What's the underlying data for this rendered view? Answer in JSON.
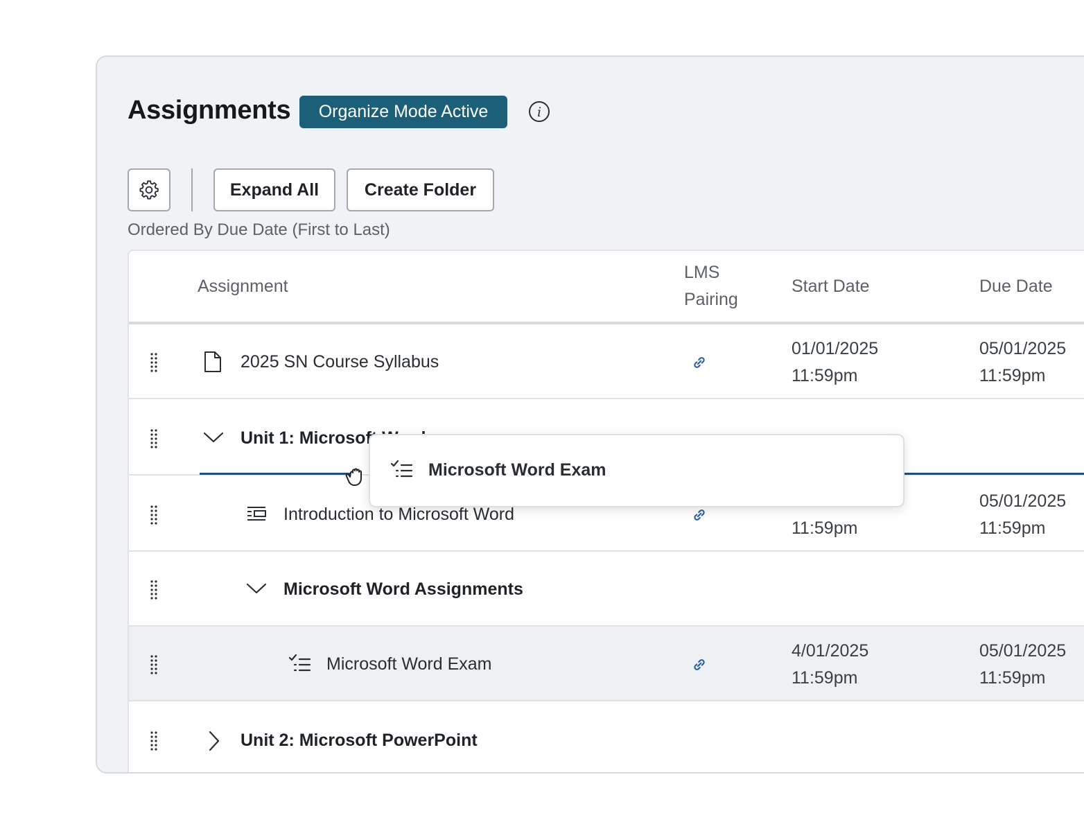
{
  "header": {
    "title": "Assignments",
    "badge": "Organize Mode Active",
    "info_icon": "info-icon"
  },
  "toolbar": {
    "settings_icon": "gear-icon",
    "expand_all": "Expand All",
    "create_folder": "Create Folder",
    "order_text": "Ordered By Due Date (First to Last)"
  },
  "table": {
    "columns": {
      "assignment": "Assignment",
      "lms_line1": "LMS",
      "lms_line2": "Pairing",
      "start": "Start Date",
      "due": "Due Date"
    },
    "rows": [
      {
        "type": "file",
        "title": "2025 SN Course Syllabus",
        "start_date": "01/01/2025",
        "start_time": "11:59pm",
        "due_date": "05/01/2025",
        "due_time": "11:59pm"
      },
      {
        "type": "folder",
        "title": "Unit 1: Microsoft Word"
      },
      {
        "type": "lesson",
        "title": "Introduction to Microsoft Word",
        "start_time": "11:59pm",
        "due_date": "05/01/2025",
        "due_time": "11:59pm"
      },
      {
        "type": "folder",
        "title": "Microsoft Word Assignments"
      },
      {
        "type": "exam",
        "title": "Microsoft Word Exam",
        "start_date": "4/01/2025",
        "start_time": "11:59pm",
        "due_date": "05/01/2025",
        "due_time": "11:59pm"
      },
      {
        "type": "folder",
        "title": "Unit 2: Microsoft PowerPoint"
      }
    ]
  },
  "drag_ghost": {
    "title": "Microsoft Word Exam"
  },
  "colors": {
    "accent": "#1c5f79",
    "link": "#2d5fa0",
    "drop_line": "#1f4f7a"
  }
}
